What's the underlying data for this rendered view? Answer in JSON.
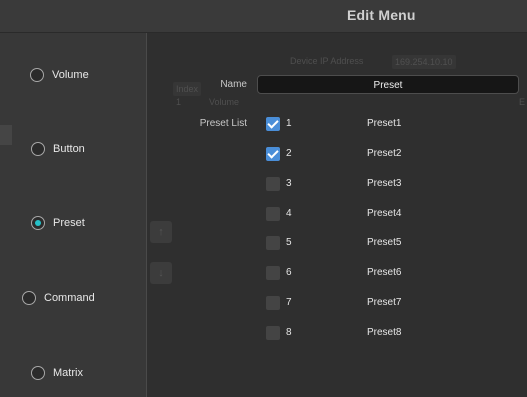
{
  "window": {
    "title": "Edit Menu"
  },
  "sidebar": {
    "items": [
      {
        "label": "Volume",
        "checked": false
      },
      {
        "label": "Button",
        "checked": false
      },
      {
        "label": "Preset",
        "checked": true
      },
      {
        "label": "Command",
        "checked": false
      },
      {
        "label": "Matrix",
        "checked": false
      }
    ]
  },
  "background": {
    "ip_label": "Device IP Address",
    "ip_value": "169.254.10.10",
    "index_header": "Index",
    "row1_index": "1",
    "row1_type": "Volume",
    "row1_tail": "E"
  },
  "form": {
    "name_label": "Name",
    "name_value": "Preset",
    "preset_list_label": "Preset List"
  },
  "presets": [
    {
      "number": "1",
      "name": "Preset1",
      "checked": true
    },
    {
      "number": "2",
      "name": "Preset2",
      "checked": true
    },
    {
      "number": "3",
      "name": "Preset3",
      "checked": false
    },
    {
      "number": "4",
      "name": "Preset4",
      "checked": false
    },
    {
      "number": "5",
      "name": "Preset5",
      "checked": false
    },
    {
      "number": "6",
      "name": "Preset6",
      "checked": false
    },
    {
      "number": "7",
      "name": "Preset7",
      "checked": false
    },
    {
      "number": "8",
      "name": "Preset8",
      "checked": false
    }
  ],
  "colors": {
    "accent_radio": "#25c0c8",
    "checkbox_checked": "#4a8ed8",
    "background": "#2f2f2f"
  }
}
